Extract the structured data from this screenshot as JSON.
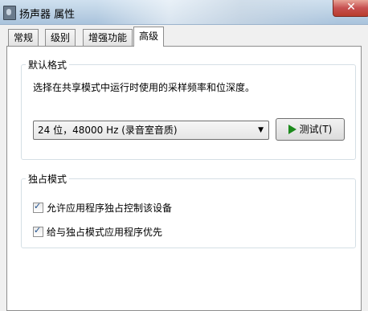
{
  "window": {
    "title": "扬声器 属性",
    "close_glyph": "✕"
  },
  "tabs": [
    {
      "label": "常规"
    },
    {
      "label": "级别"
    },
    {
      "label": "增强功能"
    },
    {
      "label": "高级"
    }
  ],
  "default_format": {
    "group_label": "默认格式",
    "description": "选择在共享模式中运行时使用的采样频率和位深度。",
    "selected_value": "24 位，48000 Hz (录音室音质)",
    "test_button_label": "测试(T)"
  },
  "exclusive_mode": {
    "group_label": "独占模式",
    "options": [
      {
        "label": "允许应用程序独占控制该设备",
        "checked": true
      },
      {
        "label": "给与独占模式应用程序优先",
        "checked": true
      }
    ],
    "check_glyph": "✓"
  },
  "colors": {
    "accent": "#1d8a1d",
    "close_red": "#c75050"
  }
}
